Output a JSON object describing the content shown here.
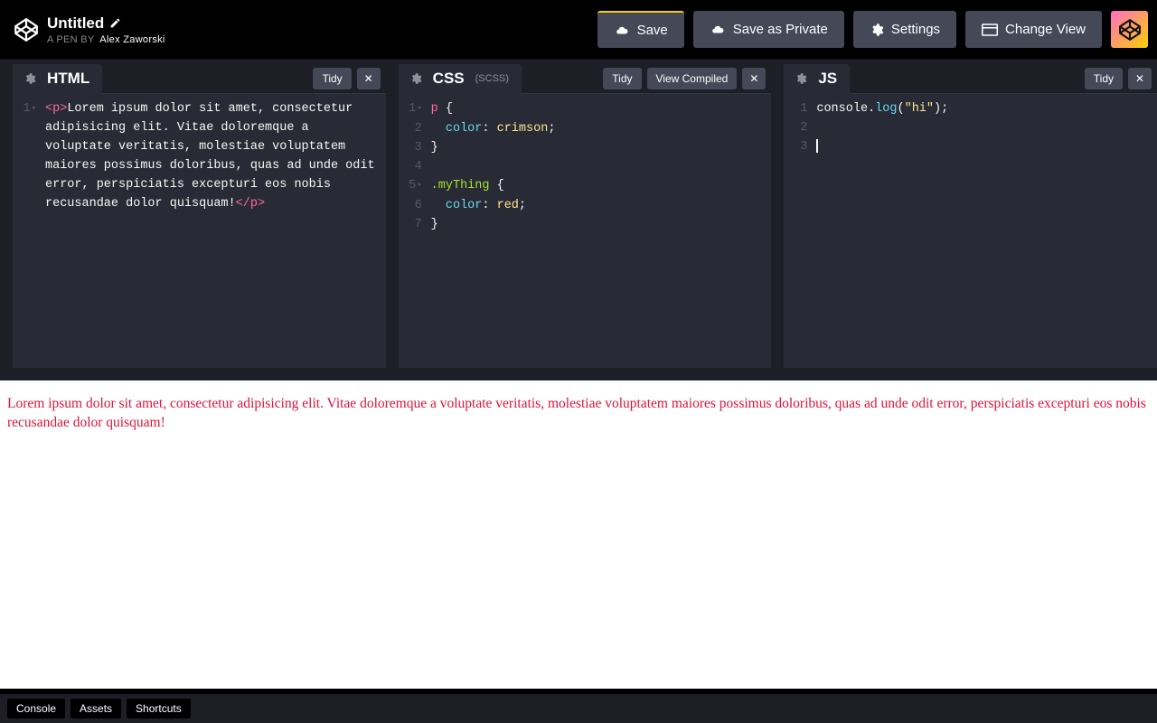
{
  "header": {
    "title": "Untitled",
    "byline_prefix": "A PEN BY",
    "author": "Alex Zaworski",
    "save": "Save",
    "save_private": "Save as Private",
    "settings": "Settings",
    "change_view": "Change View"
  },
  "panels": {
    "html": {
      "title": "HTML",
      "tidy": "Tidy",
      "code": {
        "tag_open": "<p>",
        "body": "Lorem ipsum dolor sit amet, consectetur adipisicing elit. Vitae doloremque a voluptate veritatis, molestiae voluptatem maiores possimus doloribus, quas ad unde odit error, perspiciatis excepturi eos nobis recusandae dolor quisquam!",
        "tag_close": "</p>"
      }
    },
    "css": {
      "title": "CSS",
      "sub": "(SCSS)",
      "tidy": "Tidy",
      "view_compiled": "View Compiled",
      "lines": {
        "l1": {
          "sel": "p",
          "punc": " {"
        },
        "l2": {
          "indent": "  ",
          "prop": "color",
          "sep": ": ",
          "val": "crimson",
          "end": ";"
        },
        "l3": {
          "punc": "}"
        },
        "l4": "",
        "l5": {
          "sel": ".myThing",
          "punc": " {"
        },
        "l6": {
          "indent": "  ",
          "prop": "color",
          "sep": ": ",
          "val": "red",
          "end": ";"
        },
        "l7": {
          "punc": "}"
        }
      }
    },
    "js": {
      "title": "JS",
      "tidy": "Tidy",
      "lines": {
        "l1": {
          "obj": "console",
          "dot": ".",
          "method": "log",
          "open": "(",
          "str": "\"hi\"",
          "close": ")",
          "end": ";"
        },
        "l2": "",
        "l3": ""
      }
    }
  },
  "preview": {
    "text": "Lorem ipsum dolor sit amet, consectetur adipisicing elit. Vitae doloremque a voluptate veritatis, molestiae voluptatem maiores possimus doloribus, quas ad unde odit error, perspiciatis excepturi eos nobis recusandae dolor quisquam!"
  },
  "footer": {
    "console": "Console",
    "assets": "Assets",
    "shortcuts": "Shortcuts"
  }
}
